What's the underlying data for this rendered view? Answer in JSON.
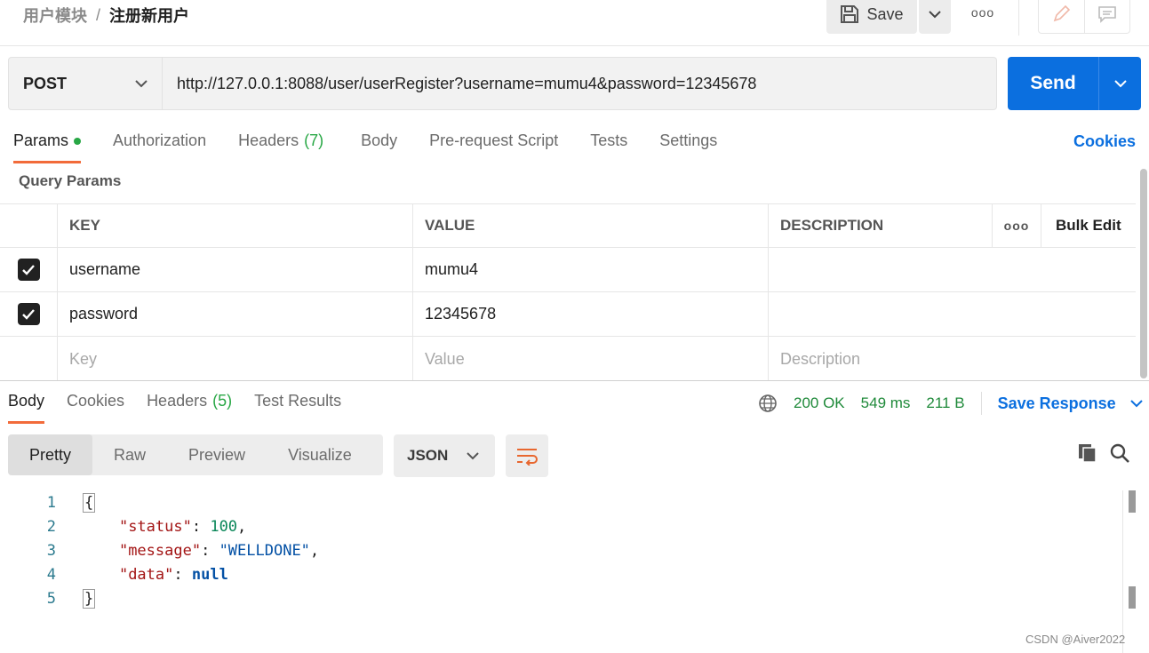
{
  "breadcrumb": {
    "parent": "用户模块",
    "separator": "/",
    "current": "注册新用户"
  },
  "toolbar": {
    "save_label": "Save",
    "more": "ooo"
  },
  "request": {
    "method": "POST",
    "url": "http://127.0.0.1:8088/user/userRegister?username=mumu4&password=12345678",
    "send_label": "Send"
  },
  "request_tabs": {
    "params": "Params",
    "authorization": "Authorization",
    "headers": "Headers",
    "headers_count": "(7)",
    "body": "Body",
    "prerequest": "Pre-request Script",
    "tests": "Tests",
    "settings": "Settings",
    "cookies": "Cookies"
  },
  "query_params": {
    "title": "Query Params",
    "columns": {
      "key": "KEY",
      "value": "VALUE",
      "description": "DESCRIPTION",
      "more": "ooo",
      "bulk_edit": "Bulk Edit"
    },
    "rows": [
      {
        "key": "username",
        "value": "mumu4",
        "description": "",
        "checked": true
      },
      {
        "key": "password",
        "value": "12345678",
        "description": "",
        "checked": true
      }
    ],
    "placeholder": {
      "key": "Key",
      "value": "Value",
      "description": "Description"
    }
  },
  "response_tabs": {
    "body": "Body",
    "cookies": "Cookies",
    "headers": "Headers",
    "headers_count": "(5)",
    "test_results": "Test Results"
  },
  "response_status": {
    "status": "200 OK",
    "time": "549 ms",
    "size": "211 B",
    "save_response": "Save Response"
  },
  "view_modes": {
    "pretty": "Pretty",
    "raw": "Raw",
    "preview": "Preview",
    "visualize": "Visualize",
    "format": "JSON"
  },
  "code": {
    "line_numbers": [
      "1",
      "2",
      "3",
      "4",
      "5"
    ],
    "open_brace": "{",
    "close_brace": "}",
    "status_key": "\"status\"",
    "status_value": "100",
    "message_key": "\"message\"",
    "message_value": "\"WELLDONE\"",
    "data_key": "\"data\"",
    "data_value": "null"
  },
  "watermark": "CSDN @Aiver2022",
  "colors": {
    "accent": "#0b6fdf",
    "active_tab": "#f26b3a",
    "success": "#28a745"
  }
}
